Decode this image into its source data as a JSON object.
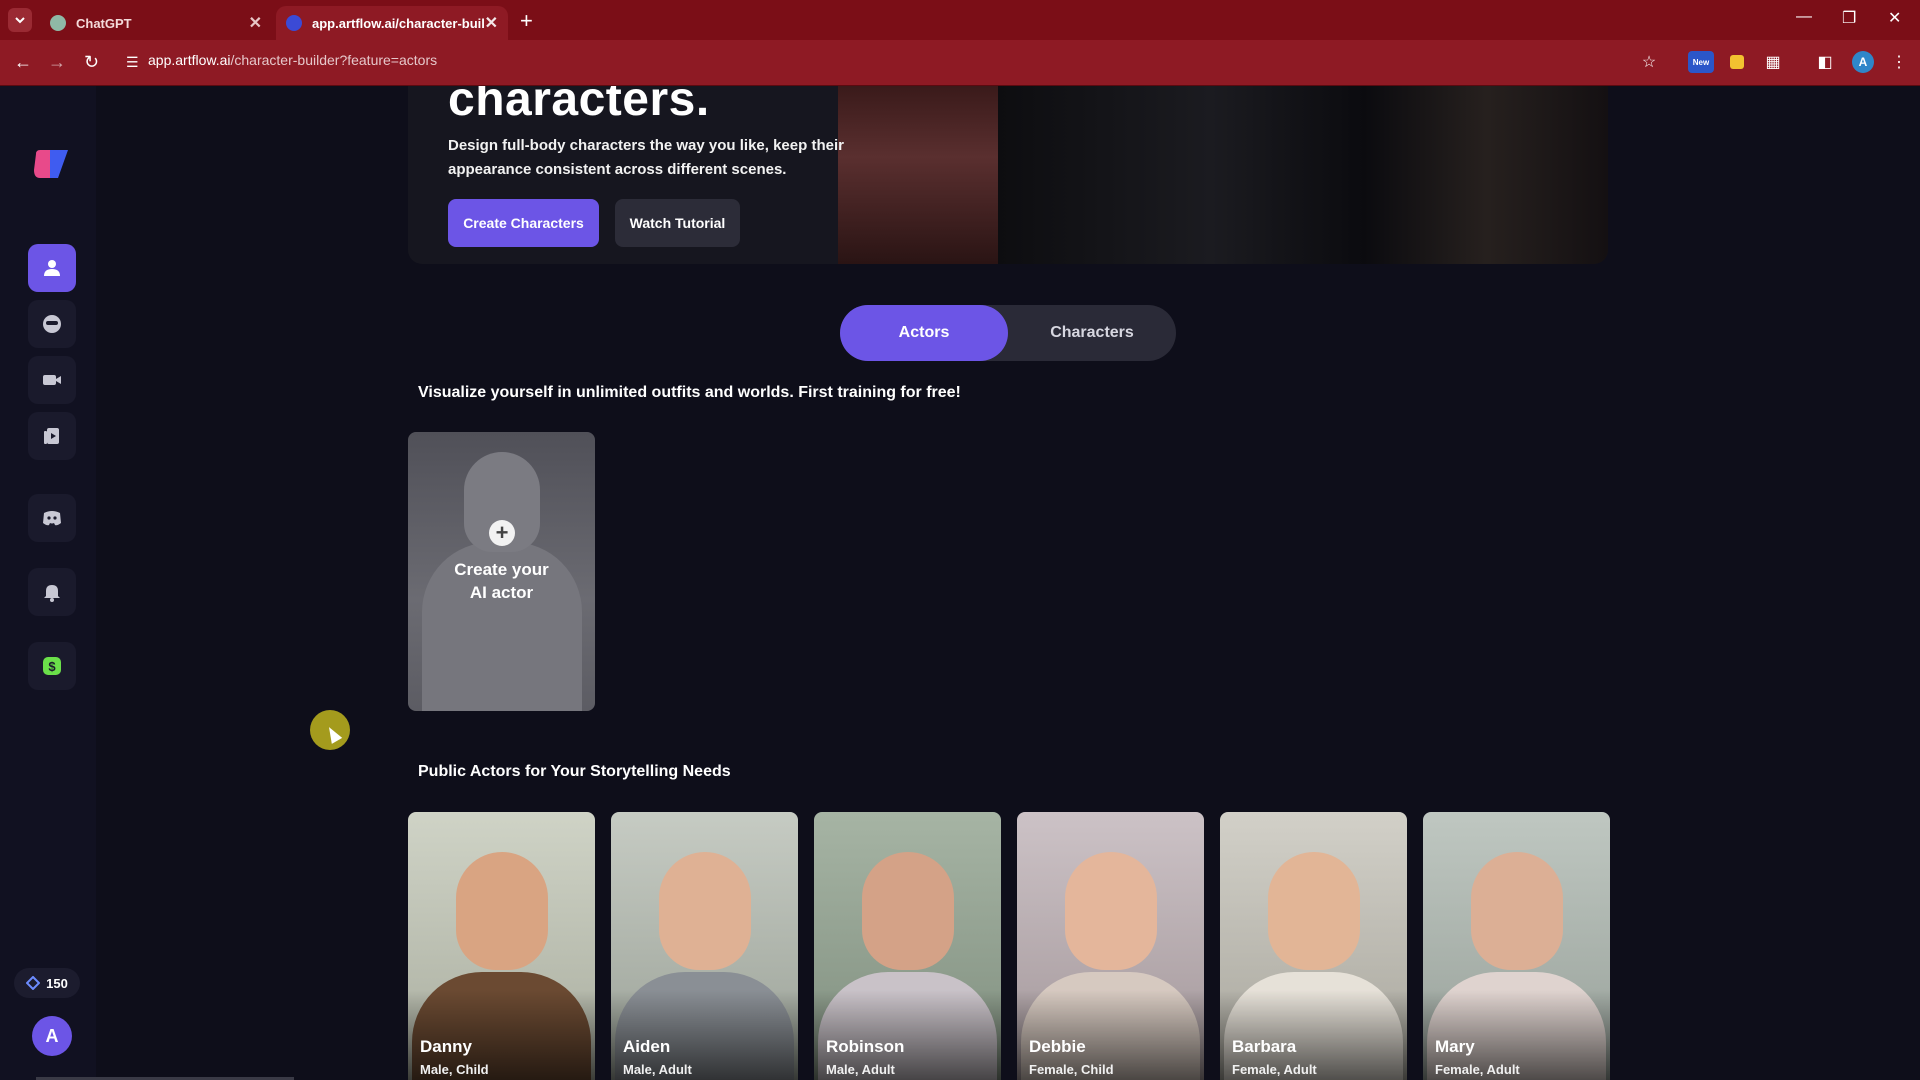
{
  "browser": {
    "tabs": [
      {
        "title": "ChatGPT",
        "close": "✕"
      },
      {
        "title": "app.artflow.ai/character-builder",
        "close": "✕"
      }
    ],
    "new_tab": "+",
    "url_host": "app.artflow.ai",
    "url_path": "/character-builder?feature=actors",
    "profile_initial": "A",
    "new_badge": "New"
  },
  "sidebar": {
    "credits": "150",
    "avatar_initial": "A"
  },
  "hero": {
    "title": "characters.",
    "description": "Design full-body characters the way you like, keep their appearance consistent across different scenes.",
    "primary_button": "Create Characters",
    "secondary_button": "Watch Tutorial"
  },
  "toggle": {
    "actors": "Actors",
    "characters": "Characters"
  },
  "actors_section": {
    "subtitle": "Visualize yourself in unlimited outfits and worlds. First training for free!",
    "create_card_label": "Create your AI actor",
    "plus": "+"
  },
  "public_section": {
    "title": "Public Actors for Your Storytelling Needs",
    "actors": [
      {
        "name": "Danny",
        "meta": "Male, Child"
      },
      {
        "name": "Aiden",
        "meta": "Male, Adult"
      },
      {
        "name": "Robinson",
        "meta": "Male, Adult"
      },
      {
        "name": "Debbie",
        "meta": "Female, Child"
      },
      {
        "name": "Barbara",
        "meta": "Female, Adult"
      },
      {
        "name": "Mary",
        "meta": "Female, Adult"
      }
    ]
  },
  "colors": {
    "accent": "#6c55e6",
    "browser_frame": "#7b0e17",
    "background": "#0e0e1a"
  }
}
